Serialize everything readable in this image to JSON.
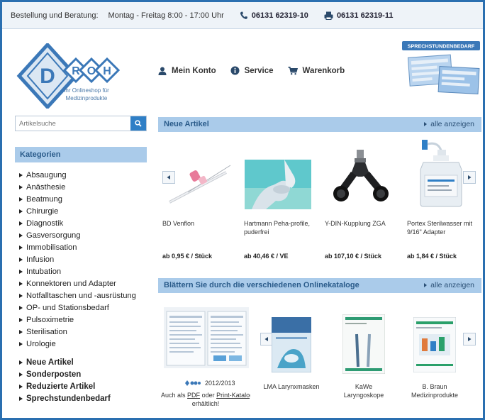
{
  "topbar": {
    "label": "Bestellung und Beratung:",
    "hours": "Montag - Freitag   8:00 - 17:00 Uhr",
    "phone": "06131 62319-10",
    "fax": "06131 62319-11"
  },
  "logo": {
    "letters": [
      "D",
      "R",
      "O",
      "H"
    ],
    "tagline_1": "Ihr Onlineshop für",
    "tagline_2": "Medizinprodukte"
  },
  "header_nav": {
    "account": "Mein Konto",
    "service": "Service",
    "cart": "Warenkorb"
  },
  "promo": {
    "label": "SPRECHSTUNDENBEDARF"
  },
  "search": {
    "placeholder": "Artikelsuche"
  },
  "sidebar": {
    "heading": "Kategorien",
    "categories": [
      "Absaugung",
      "Anästhesie",
      "Beatmung",
      "Chirurgie",
      "Diagnostik",
      "Gasversorgung",
      "Immobilisation",
      "Infusion",
      "Intubation",
      "Konnektoren und Adapter",
      "Notfalltaschen und -ausrüstung",
      "OP- und Stationsbedarf",
      "Pulsoximetrie",
      "Sterilisation",
      "Urologie"
    ],
    "specials": [
      "Neue Artikel",
      "Sonderposten",
      "Reduzierte Artikel",
      "Sprechstundenbedarf"
    ]
  },
  "new_articles": {
    "heading": "Neue Artikel",
    "show_all": "alle anzeigen",
    "products": [
      {
        "name": "BD Venflon",
        "price": "ab 0,95 € / Stück"
      },
      {
        "name": "Hartmann Peha-profile, puderfrei",
        "price": "ab 40,46 € / VE"
      },
      {
        "name": "Y-DIN-Kupplung ZGA",
        "price": "ab 107,10 € / Stück"
      },
      {
        "name": "Portex Sterilwasser mit 9/16\" Adapter",
        "price": "ab 1,84 € / Stück"
      }
    ]
  },
  "catalogs": {
    "heading": "Blättern Sie durch die verschiedenen Onlinekataloge",
    "show_all": "alle anzeigen",
    "main_year": "2012/2013",
    "note_prefix": "Auch als",
    "pdf_link": "PDF",
    "note_or": "oder",
    "print_link": "Print-Katalog",
    "note_suffix": "erhältlich!",
    "items": [
      {
        "name_1": "LMA Larynxmasken",
        "name_2": ""
      },
      {
        "name_1": "KaWe",
        "name_2": "Laryngoskope"
      },
      {
        "name_1": "B. Braun",
        "name_2": "Medizinprodukte"
      }
    ]
  },
  "colors": {
    "accent": "#2f7fc6",
    "bar": "#aacbea",
    "bar_text": "#2a5b8a",
    "logo": "#3b78b8"
  }
}
